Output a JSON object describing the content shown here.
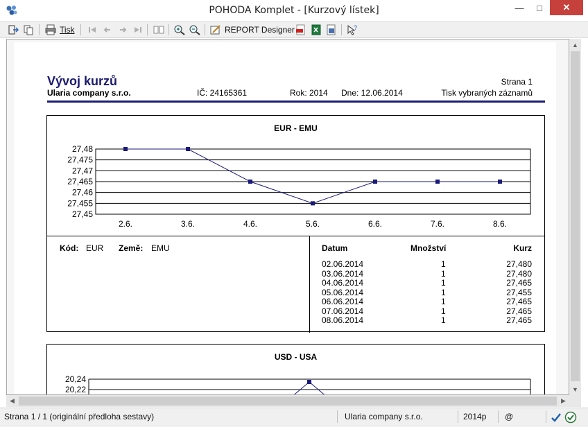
{
  "window": {
    "title": "POHODA Komplet - [Kurzový lístek]"
  },
  "toolbar": {
    "print_label": "Tisk",
    "report_designer_label": "REPORT Designer"
  },
  "report": {
    "title": "Vývoj kurzů",
    "company": "Ularia company s.r.o.",
    "page": "Strana 1",
    "ic": "IČ: 24165361",
    "rok": "Rok: 2014",
    "dne": "Dne: 12.06.2014",
    "tisk": "Tisk vybraných záznamů"
  },
  "chart_data": [
    {
      "type": "line",
      "title": "EUR - EMU",
      "categories": [
        "2.6.",
        "3.6.",
        "4.6.",
        "5.6.",
        "6.6.",
        "7.6.",
        "8.6."
      ],
      "values": [
        27.48,
        27.48,
        27.465,
        27.455,
        27.465,
        27.465,
        27.465
      ],
      "ylim": [
        27.45,
        27.48
      ],
      "yticks": [
        "27,48",
        "27,475",
        "27,47",
        "27,465",
        "27,46",
        "27,455",
        "27,45"
      ],
      "grid": true,
      "color": "#1a1a7a"
    },
    {
      "type": "line",
      "title": "USD - USA",
      "yticks": [
        "20,24",
        "20,22"
      ],
      "grid": true,
      "color": "#1a1a7a"
    }
  ],
  "info": {
    "kod_label": "Kód:",
    "kod_value": "EUR",
    "zeme_label": "Země:",
    "zeme_value": "EMU",
    "headers": {
      "datum": "Datum",
      "mnozstvi": "Množství",
      "kurz": "Kurz"
    },
    "rows": [
      {
        "datum": "02.06.2014",
        "mnozstvi": "1",
        "kurz": "27,480"
      },
      {
        "datum": "03.06.2014",
        "mnozstvi": "1",
        "kurz": "27,480"
      },
      {
        "datum": "04.06.2014",
        "mnozstvi": "1",
        "kurz": "27,465"
      },
      {
        "datum": "05.06.2014",
        "mnozstvi": "1",
        "kurz": "27,455"
      },
      {
        "datum": "06.06.2014",
        "mnozstvi": "1",
        "kurz": "27,465"
      },
      {
        "datum": "07.06.2014",
        "mnozstvi": "1",
        "kurz": "27,465"
      },
      {
        "datum": "08.06.2014",
        "mnozstvi": "1",
        "kurz": "27,465"
      }
    ]
  },
  "status": {
    "page": "Strana 1 / 1  (originální předloha sestavy)",
    "company": "Ularia company s.r.o.",
    "year": "2014p",
    "at": "@"
  }
}
